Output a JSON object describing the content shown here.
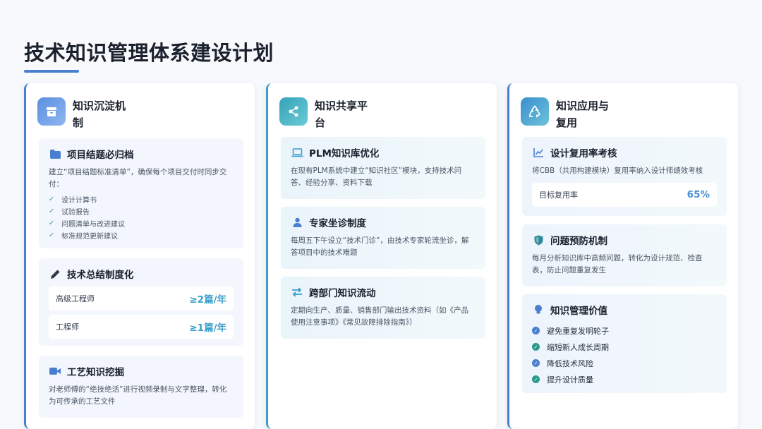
{
  "page": {
    "title": "技术知识管理体系建设计划"
  },
  "col1": {
    "title": "知识沉淀机制",
    "card1": {
      "title": "项目结题必归档",
      "desc": "建立“项目结题标准清单”，确保每个项目交付时同步交付：",
      "items": [
        "设计计算书",
        "试验报告",
        "问题清单与改进建议",
        "标准规范更新建议"
      ]
    },
    "card2": {
      "title": "技术总结制度化",
      "rows": [
        {
          "label": "高级工程师",
          "value": "≥2篇/年"
        },
        {
          "label": "工程师",
          "value": "≥1篇/年"
        }
      ]
    },
    "card3": {
      "title": "工艺知识挖掘",
      "desc": "对老师傅的“绝技绝活”进行视频录制与文字整理，转化为可传承的工艺文件"
    }
  },
  "col2": {
    "title": "知识共享平台",
    "card1": {
      "title": "PLM知识库优化",
      "desc": "在现有PLM系统中建立“知识社区”模块，支持技术问答、经验分享、资料下载"
    },
    "card2": {
      "title": "专家坐诊制度",
      "desc": "每周五下午设立“技术门诊”，由技术专家轮流坐诊，解答项目中的技术难题"
    },
    "card3": {
      "title": "跨部门知识流动",
      "desc": "定期向生产、质量、销售部门输出技术资料（如《产品使用注意事项》《常见故障排除指南》）"
    }
  },
  "col3": {
    "title": "知识应用与复用",
    "card1": {
      "title": "设计复用率考核",
      "desc": "将CBB（共用构建模块）复用率纳入设计师绩效考核",
      "metric_label": "目标复用率",
      "metric_value": "65%"
    },
    "card2": {
      "title": "问题预防机制",
      "desc": "每月分析知识库中高频问题，转化为设计规范、检查表，防止问题重复发生"
    },
    "card3": {
      "title": "知识管理价值",
      "items": [
        "避免重复发明轮子",
        "缩短新人成长周期",
        "降低技术风险",
        "提升设计质量"
      ]
    }
  },
  "colors": {
    "accent_blue": "#4a7fd0",
    "accent_teal": "#3a9fc9",
    "check_green": "#4a9a8a"
  },
  "icons": {
    "col1": "archive-box-icon",
    "col2": "share-icon",
    "col3": "recycle-icon",
    "folder": "folder-icon",
    "pen": "pen-icon",
    "video": "video-camera-icon",
    "laptop": "laptop-icon",
    "expert": "user-doctor-icon",
    "exchange": "arrows-exchange-icon",
    "chart": "line-chart-icon",
    "shield": "shield-icon",
    "bulb": "lightbulb-icon"
  }
}
